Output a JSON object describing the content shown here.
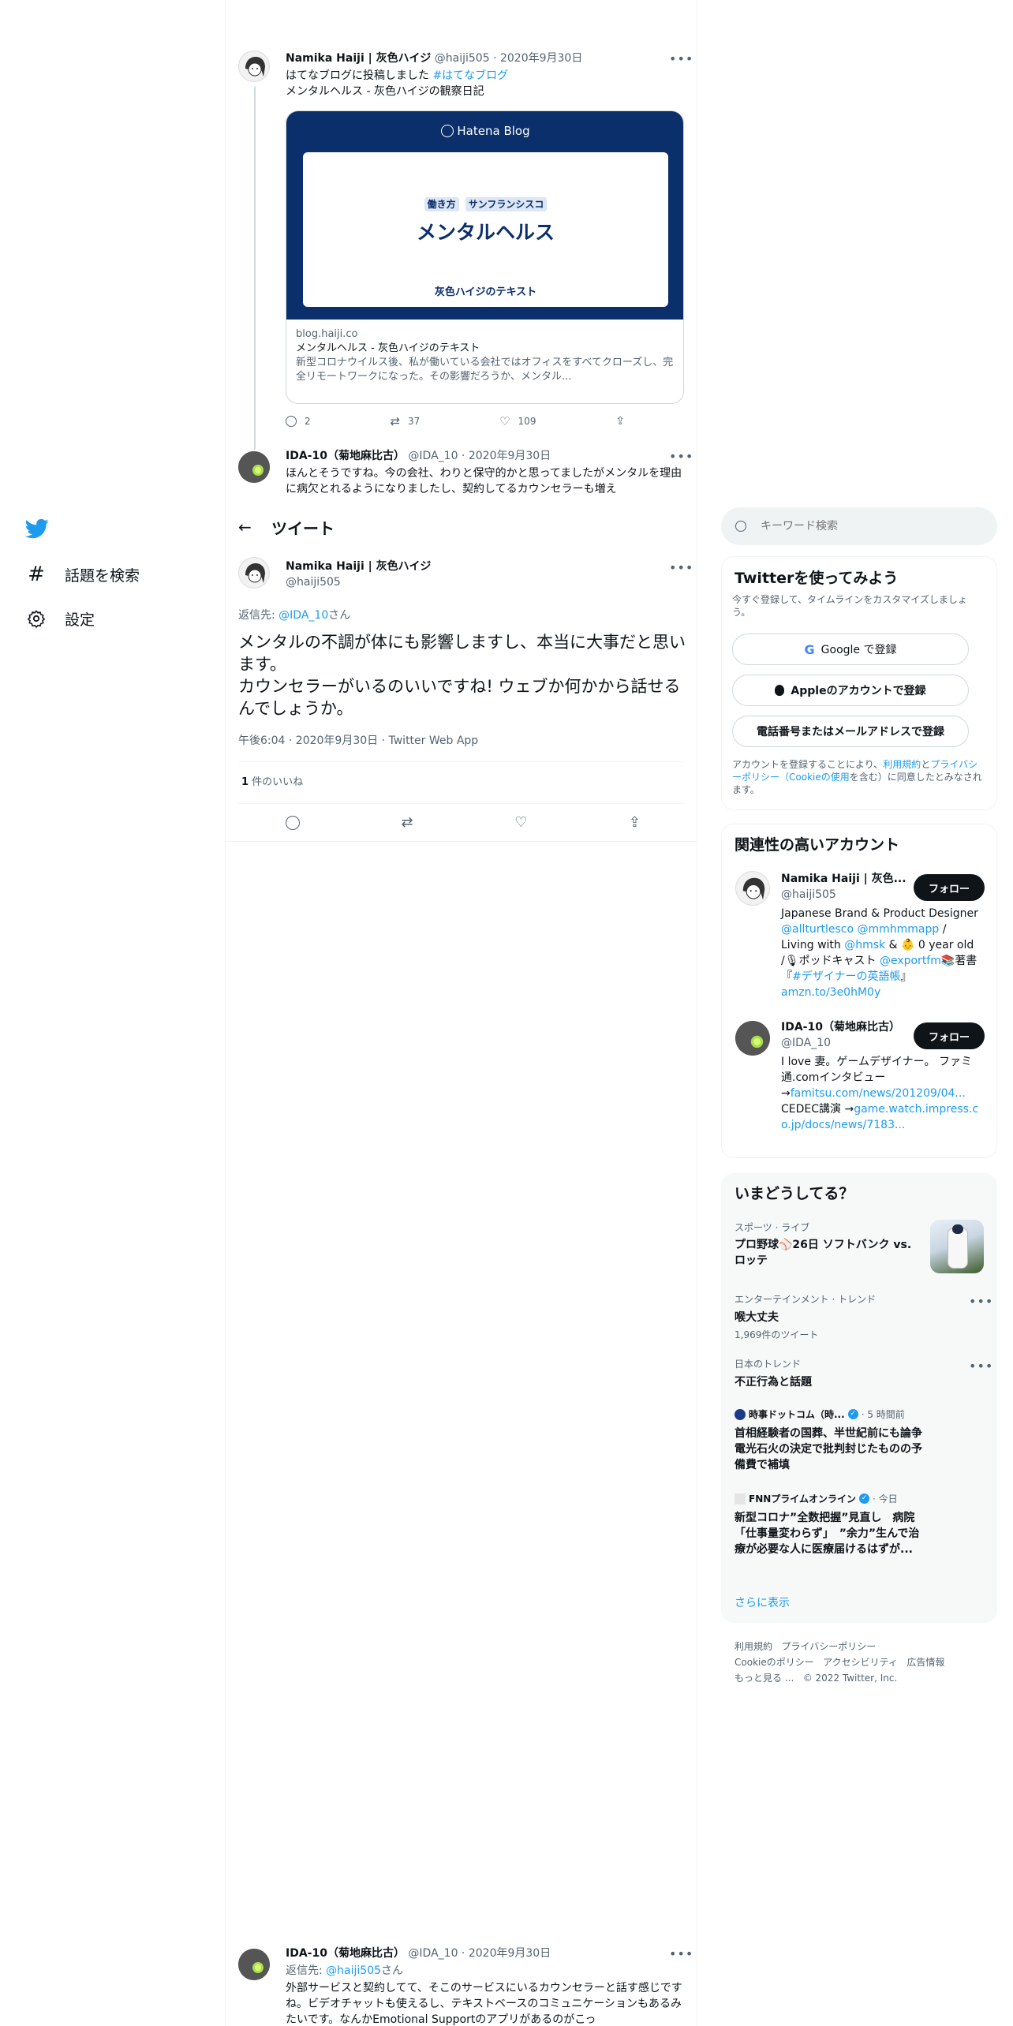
{
  "nav": {
    "explore": "話題を検索",
    "settings": "設定"
  },
  "tweet1": {
    "name": "Namika Haiji | 灰色ハイジ",
    "handle": "@haiji505",
    "date": "2020年9月30日",
    "text1": "はてなブログに投稿しました ",
    "hashtag": "#はてなブログ",
    "text2": "メンタルヘルス - 灰色ハイジの観察日記",
    "card": {
      "brand": "Hatena Blog",
      "tag1": "働き方",
      "tag2": "サンフランシスコ",
      "headline": "メンタルヘルス",
      "footer": "灰色ハイジのテキスト",
      "domain": "blog.haiji.co",
      "title": "メンタルヘルス - 灰色ハイジのテキスト",
      "desc": "新型コロナウイルス後、私が働いている会社ではオフィスをすべてクローズし、完全リモートワークになった。その影響だろうか、メンタル..."
    },
    "replies": "2",
    "retweets": "37",
    "likes": "109"
  },
  "tweet2": {
    "name": "IDA-10（菊地麻比古）",
    "handle": "@IDA_10",
    "date": "2020年9月30日",
    "text": "ほんとそうですね。今の会社、わりと保守的かと思ってましたがメンタルを理由に病欠とれるようになりましたし、契約してるカウンセラーも増え"
  },
  "header": {
    "title": "ツイート"
  },
  "main": {
    "name": "Namika Haiji | 灰色ハイジ",
    "handle": "@haiji505",
    "reply_prefix": "返信先: ",
    "reply_to": "@IDA_10",
    "reply_suffix": "さん",
    "text": "メンタルの不調が体にも影響しますし、本当に大事だと思います。\nカウンセラーがいるのいいですね! ウェブか何かから話せるんでしょうか。",
    "meta": "午後6:04 · 2020年9月30日 · Twitter Web App",
    "likes_count": "1",
    "likes_label": " 件のいいね"
  },
  "tweet3": {
    "name": "IDA-10（菊地麻比古）",
    "handle": "@IDA_10",
    "date": "2020年9月30日",
    "reply_prefix": "返信先: ",
    "reply_to": "@haiji505",
    "reply_suffix": "さん",
    "text": "外部サービスと契約してて、そこのサービスにいるカウンセラーと話す感じですね。ビデオチャットも使えるし、テキストベースのコミュニケーションもあるみたいです。なんかEmotional Supportのアプリがあるのがこっ"
  },
  "search": {
    "placeholder": "キーワード検索"
  },
  "signup": {
    "title": "Twitterを使ってみよう",
    "subtitle": "今すぐ登録して、タイムラインをカスタマイズしましょう。",
    "google": "Google で登録",
    "apple": "Appleのアカウントで登録",
    "phone": "電話番号またはメールアドレスで登録",
    "terms_1": "アカウントを登録することにより、",
    "terms_link1": "利用規約",
    "terms_2": "と",
    "terms_link2": "プライバシーポリシー（Cookieの使用",
    "terms_3": "を含む）に同意したとみなされます。"
  },
  "relevant": {
    "title": "関連性の高いアカウント",
    "follow": "フォロー",
    "acc1": {
      "name": "Namika Haiji | 灰色...",
      "handle": "@haiji505",
      "bio_a": "Japanese Brand & Product Designer ",
      "bio_l1": "@allturtlesco",
      "bio_sp": " ",
      "bio_l2": "@mmhmmapp",
      "bio_b": " / Living with ",
      "bio_l3": "@hmsk",
      "bio_c": " & 👶 0 year old /🎙ポッドキャスト ",
      "bio_l4": "@exportfm",
      "bio_d": "📚著書『",
      "bio_l5": "#デザイナーの英語帳",
      "bio_e": "』",
      "bio_l6": "amzn.to/3e0hM0y"
    },
    "acc2": {
      "name": "IDA-10（菊地麻比古）",
      "handle": "@IDA_10",
      "bio_a": "I love 妻。ゲームデザイナー。 ファミ通.comインタビュー →",
      "bio_l1": "famitsu.com/news/201209/04...",
      "bio_b": " CEDEC講演 →",
      "bio_l2": "game.watch.impress.co.jp/docs/news/7183..."
    }
  },
  "trends": {
    "title": "いまどうしてる？",
    "t1_cat": "スポーツ · ライブ",
    "t1_name": "プロ野球⚾26日 ソフトバンク vs. ロッテ",
    "t2_cat": "エンターテインメント · トレンド",
    "t2_name": "喉大丈夫",
    "t2_count": "1,969件のツイート",
    "t3_cat": "日本のトレンド",
    "t3_name": "不正行為と話題",
    "n1_source": "時事ドットコム（時...",
    "n1_time": "· 5 時間前",
    "n1_title": "首相経験者の国葬、半世紀前にも論争　電光石火の決定で批判封じたものの予備費で補填",
    "n2_source": "FNNプライムオンライン",
    "n2_time": "· 今日",
    "n2_title": "新型コロナ”全数把握”見直し　病院「仕事量変わらず」　”余力”生んで治療が必要な人に医療届けるはずが...",
    "more": "さらに表示"
  },
  "footer": {
    "l1": "利用規約",
    "l2": "プライバシーポリシー",
    "l3": "Cookieのポリシー",
    "l4": "アクセシビリティ",
    "l5": "広告情報",
    "l6": "もっと見る ...",
    "copy": "© 2022 Twitter, Inc."
  },
  "colors": {
    "accent": "#1d9bf0",
    "hatena_bg": "#0b2f6a",
    "text": "#0f1419",
    "muted": "#536471"
  }
}
